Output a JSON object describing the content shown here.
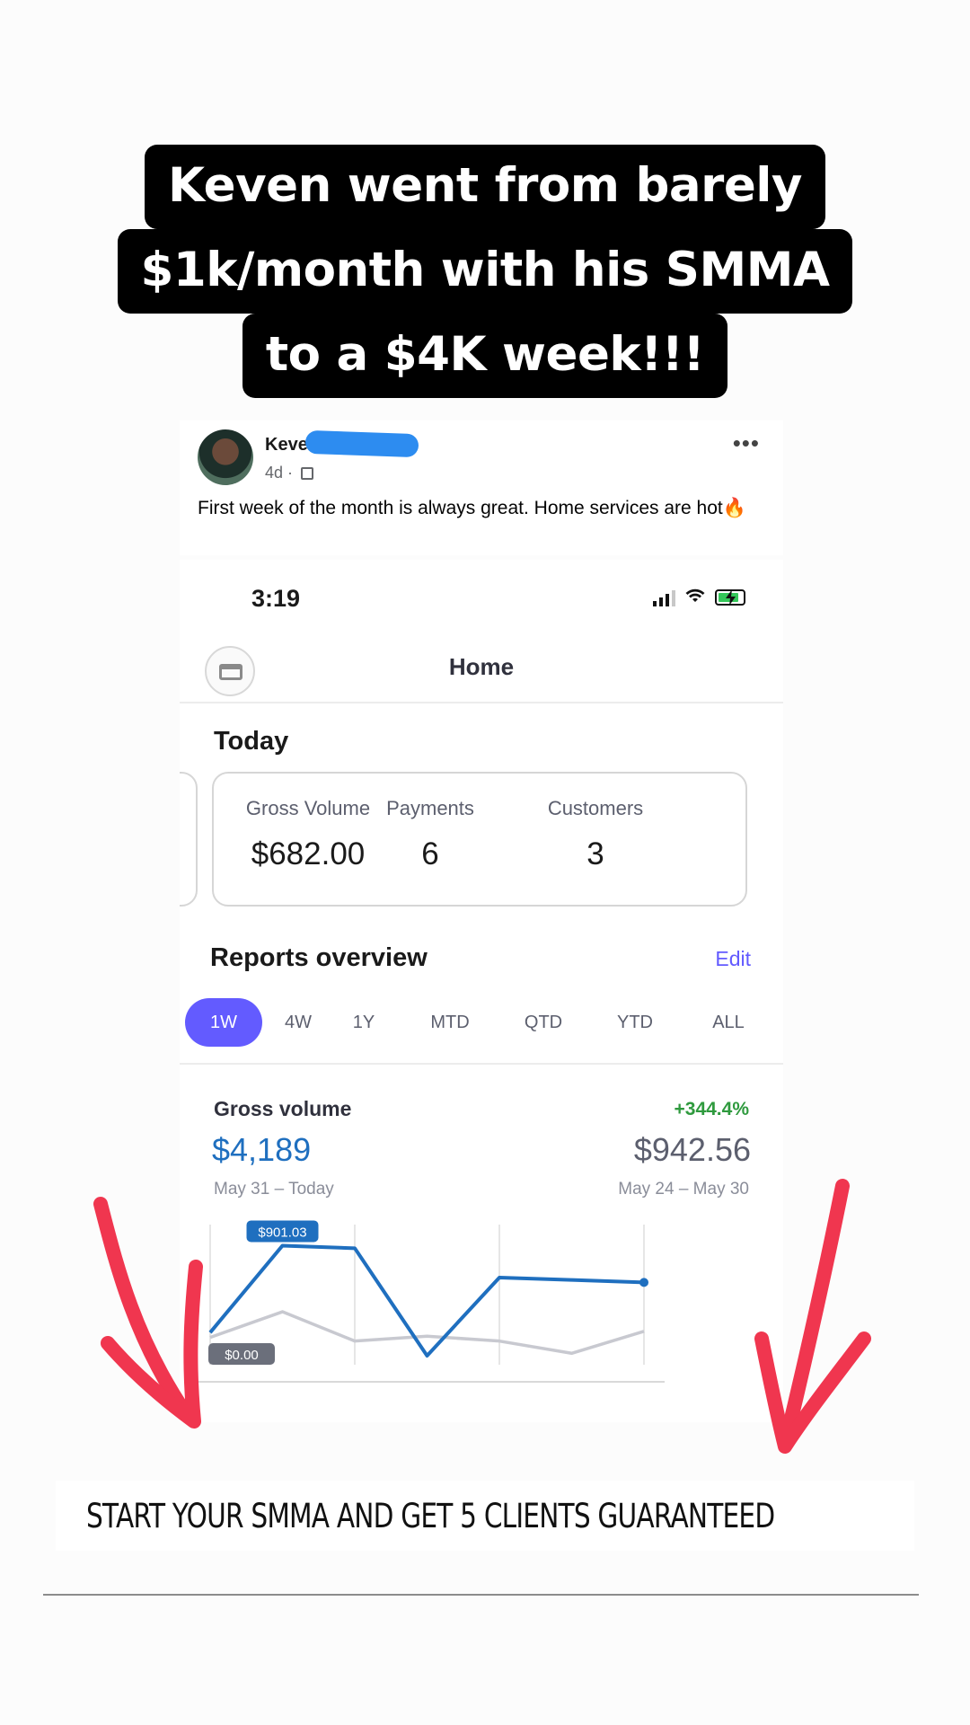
{
  "headline": {
    "line1": "Keven went from barely",
    "line2": "$1k/month with his SMMA",
    "line3": "to a $4K week!!!"
  },
  "post": {
    "author": "Keve",
    "age": "4d ·",
    "text": "First week of the month is always great. Home services are hot",
    "emoji": "🔥",
    "menu": "•••"
  },
  "phone": {
    "time": "3:19",
    "nav_title": "Home",
    "today": {
      "title": "Today",
      "metrics": [
        {
          "label": "Gross Volume",
          "value": "$682.00"
        },
        {
          "label": "Payments",
          "value": "6"
        },
        {
          "label": "Customers",
          "value": "3"
        }
      ]
    },
    "reports": {
      "title": "Reports overview",
      "edit": "Edit",
      "ranges": [
        "1W",
        "4W",
        "1Y",
        "MTD",
        "QTD",
        "YTD",
        "ALL"
      ],
      "active_range": "1W"
    },
    "gross_volume": {
      "label": "Gross volume",
      "change": "+344.4%",
      "value": "$4,189",
      "range": "May 31 – Today",
      "prev_value": "$942.56",
      "prev_range": "May 24 – May 30",
      "max_tag": "$901.03",
      "min_tag": "$0.00"
    }
  },
  "chart_data": {
    "type": "line",
    "x": [
      1,
      2,
      3,
      4,
      5,
      6,
      7
    ],
    "series": [
      {
        "values": [
          190,
          901.03,
          880,
          0,
          640,
          620,
          600
        ]
      },
      {
        "values": [
          150,
          360,
          120,
          160,
          120,
          20,
          200
        ]
      }
    ],
    "ylim": [
      0,
      1000
    ],
    "colors": [
      "#1f6fbf",
      "#c8c9d0"
    ],
    "grid": true
  },
  "cta": {
    "text": "START YOUR SMMA AND GET 5 CLIENTS GUARANTEED"
  },
  "colors": {
    "accent": "#635bff",
    "arrow": "#f0364f",
    "positive": "#2f9a3e",
    "series_current": "#1f6fbf"
  }
}
